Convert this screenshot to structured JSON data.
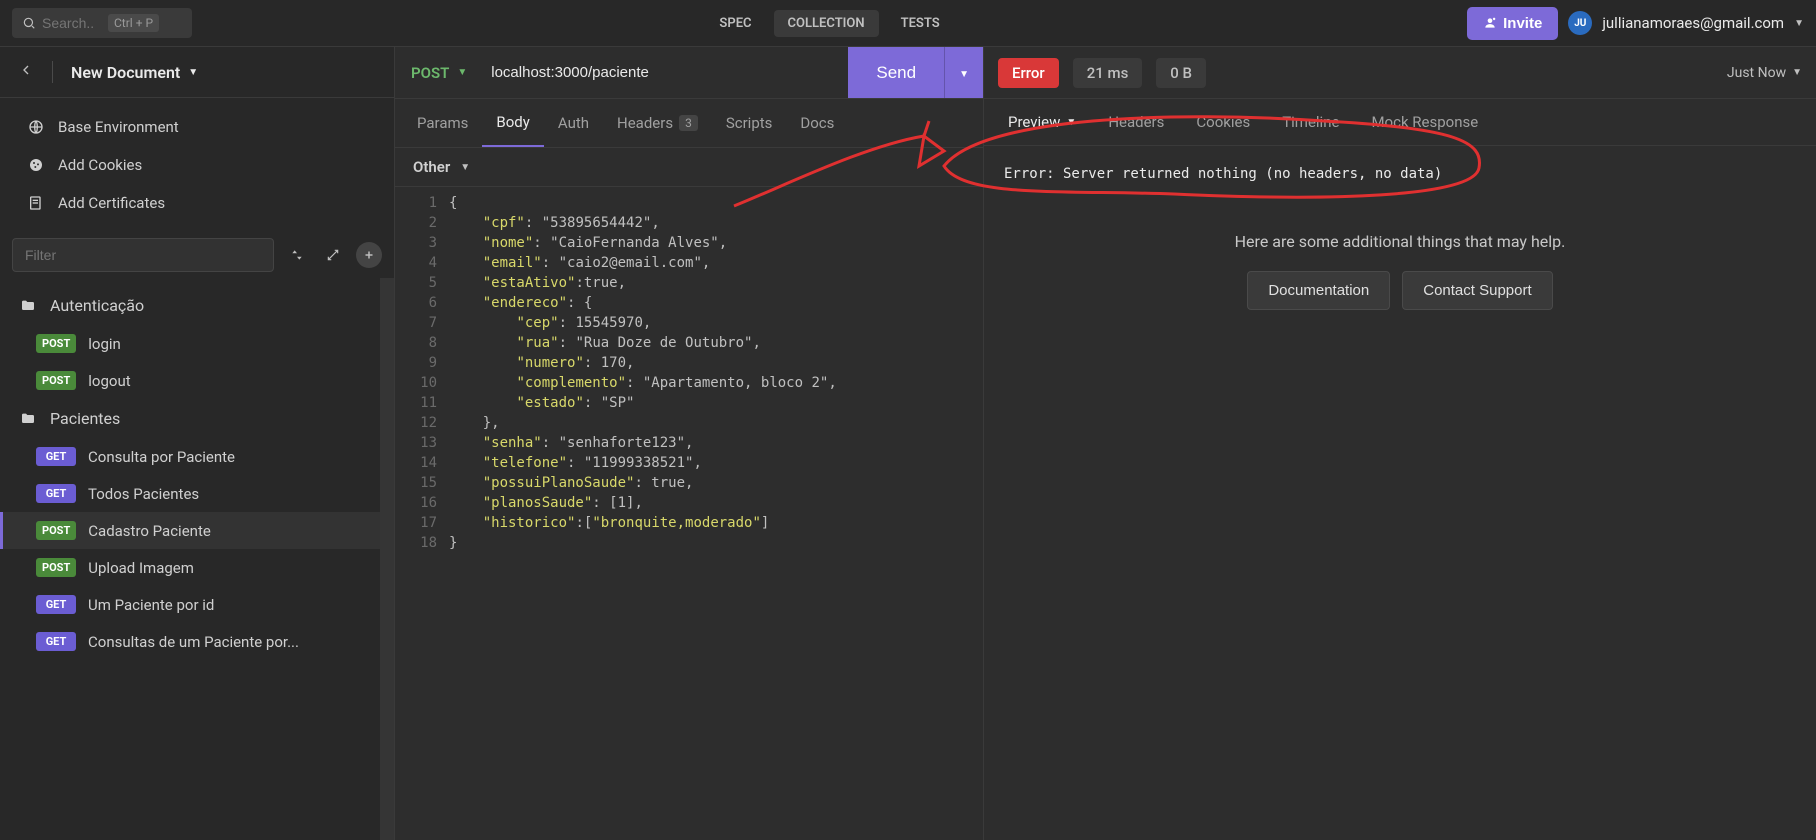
{
  "topbar": {
    "search_placeholder": "Search..",
    "search_hint": "Ctrl + P",
    "tabs": {
      "spec": "SPEC",
      "collection": "COLLECTION",
      "tests": "TESTS"
    },
    "invite_label": "Invite",
    "user_initials": "JU",
    "user_email": "jullianamoraes@gmail.com"
  },
  "doc": {
    "title": "New Document"
  },
  "sidebar": {
    "env": "Base Environment",
    "add_cookies": "Add Cookies",
    "add_certs": "Add Certificates",
    "filter_placeholder": "Filter",
    "folders": {
      "auth": "Autenticação",
      "pacientes": "Pacientes"
    },
    "items": {
      "login": {
        "method": "POST",
        "label": "login"
      },
      "logout": {
        "method": "POST",
        "label": "logout"
      },
      "consulta_paciente": {
        "method": "GET",
        "label": "Consulta por Paciente"
      },
      "todos_pacientes": {
        "method": "GET",
        "label": "Todos Pacientes"
      },
      "cadastro_paciente": {
        "method": "POST",
        "label": "Cadastro Paciente"
      },
      "upload_imagem": {
        "method": "POST",
        "label": "Upload Imagem"
      },
      "um_paciente": {
        "method": "GET",
        "label": "Um Paciente por id"
      },
      "consultas_paciente": {
        "method": "GET",
        "label": "Consultas de um Paciente por..."
      }
    }
  },
  "request": {
    "method": "POST",
    "url": "localhost:3000/paciente",
    "send_label": "Send",
    "tabs": {
      "params": "Params",
      "body": "Body",
      "auth": "Auth",
      "headers": "Headers",
      "headers_count": "3",
      "scripts": "Scripts",
      "docs": "Docs"
    },
    "body_type": "Other",
    "code_lines": [
      "{",
      "    \"cpf\": \"53895654442\",",
      "    \"nome\": \"CaioFernanda Alves\",",
      "    \"email\": \"caio2@email.com\",",
      "    \"estaAtivo\":true,",
      "    \"endereco\": {",
      "        \"cep\": 15545970,",
      "        \"rua\": \"Rua Doze de Outubro\",",
      "        \"numero\": 170,",
      "        \"complemento\": \"Apartamento, bloco 2\",",
      "        \"estado\": \"SP\"",
      "    },",
      "    \"senha\": \"senhaforte123\",",
      "    \"telefone\": \"11999338521\",",
      "    \"possuiPlanoSaude\": true,",
      "    \"planosSaude\": [1],",
      "    \"historico\":[\"bronquite,moderado\"]",
      "}"
    ]
  },
  "response": {
    "status": "Error",
    "time": "21 ms",
    "size": "0 B",
    "when": "Just Now",
    "tabs": {
      "preview": "Preview",
      "headers": "Headers",
      "cookies": "Cookies",
      "timeline": "Timeline",
      "mock": "Mock Response"
    },
    "error_text": "Error: Server returned nothing (no headers, no data)",
    "help_msg": "Here are some additional things that may help.",
    "doc_btn": "Documentation",
    "support_btn": "Contact Support"
  }
}
